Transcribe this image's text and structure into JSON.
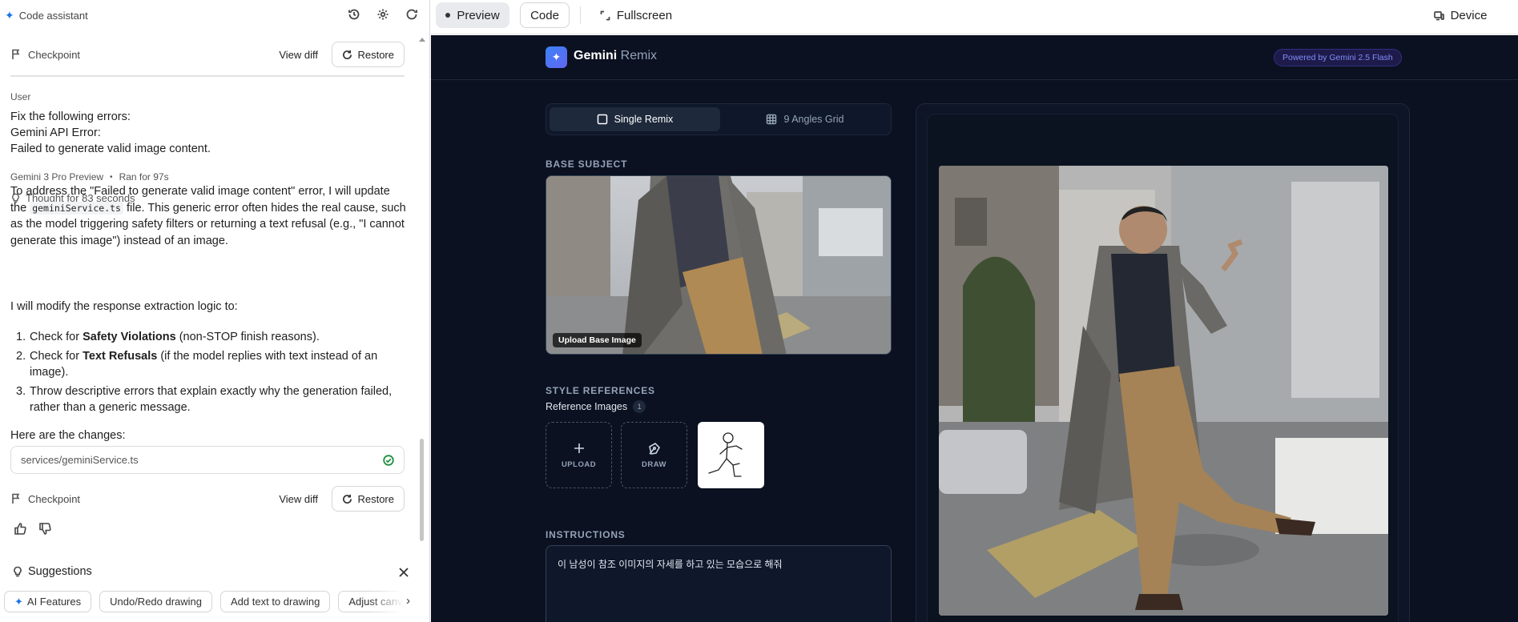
{
  "left_panel": {
    "title": "Code assistant",
    "checkpoint_top": {
      "label": "Checkpoint",
      "view_diff": "View diff",
      "restore": "Restore"
    },
    "user_label": "User",
    "user_message": [
      "Fix the following errors:",
      "Gemini API Error:",
      "Failed to generate valid image content."
    ],
    "model_name": "Gemini 3 Pro Preview",
    "run_time": "Ran for 97s",
    "thought": "Thought for 83 seconds",
    "para1_before": "To address the \"Failed to generate valid image content\" error, I will update the ",
    "para1_code": "geminiService.ts",
    "para1_after": " file. This generic error often hides the real cause, such as the model triggering safety filters or returning a text refusal (e.g., \"I cannot generate this image\") instead of an image.",
    "para2": "I will modify the response extraction logic to:",
    "steps": [
      {
        "num": "1.",
        "pre": "Check for ",
        "bold": "Safety Violations",
        "post": " (non-STOP finish reasons)."
      },
      {
        "num": "2.",
        "pre": "Check for ",
        "bold": "Text Refusals",
        "post": " (if the model replies with text instead of an image)."
      },
      {
        "num": "3.",
        "pre": "Throw descriptive errors that explain exactly why the generation failed, rather than a generic message.",
        "bold": "",
        "post": ""
      }
    ],
    "changes_label": "Here are the changes:",
    "file_name": "services/geminiService.ts",
    "checkpoint_bottom": {
      "label": "Checkpoint",
      "view_diff": "View diff",
      "restore": "Restore"
    },
    "suggestions": {
      "title": "Suggestions",
      "chips": [
        "AI Features",
        "Undo/Redo drawing",
        "Add text to drawing",
        "Adjust canvas"
      ]
    }
  },
  "toolbar": {
    "preview": "Preview",
    "code": "Code",
    "fullscreen": "Fullscreen",
    "device": "Device"
  },
  "app": {
    "brand_bold": "Gemini",
    "brand_light": " Remix",
    "powered": "Powered by Gemini 2.5 Flash",
    "tabs": {
      "single": "Single Remix",
      "grid": "9 Angles Grid"
    },
    "base_subject": "BASE SUBJECT",
    "upload_base": "Upload Base Image",
    "style_refs": "STYLE REFERENCES",
    "reference_images": "Reference Images",
    "ref_count": "1",
    "upload": "UPLOAD",
    "draw": "DRAW",
    "instructions": "INSTRUCTIONS",
    "instruction_text": "이 남성이 참조 이미지의 자세를 하고 있는 모습으로 해줘"
  },
  "colors": {
    "app_bg": "#0b1120",
    "accent": "#6366f1",
    "brand_blue": "#1a73e8",
    "success": "#1e8e3e"
  }
}
